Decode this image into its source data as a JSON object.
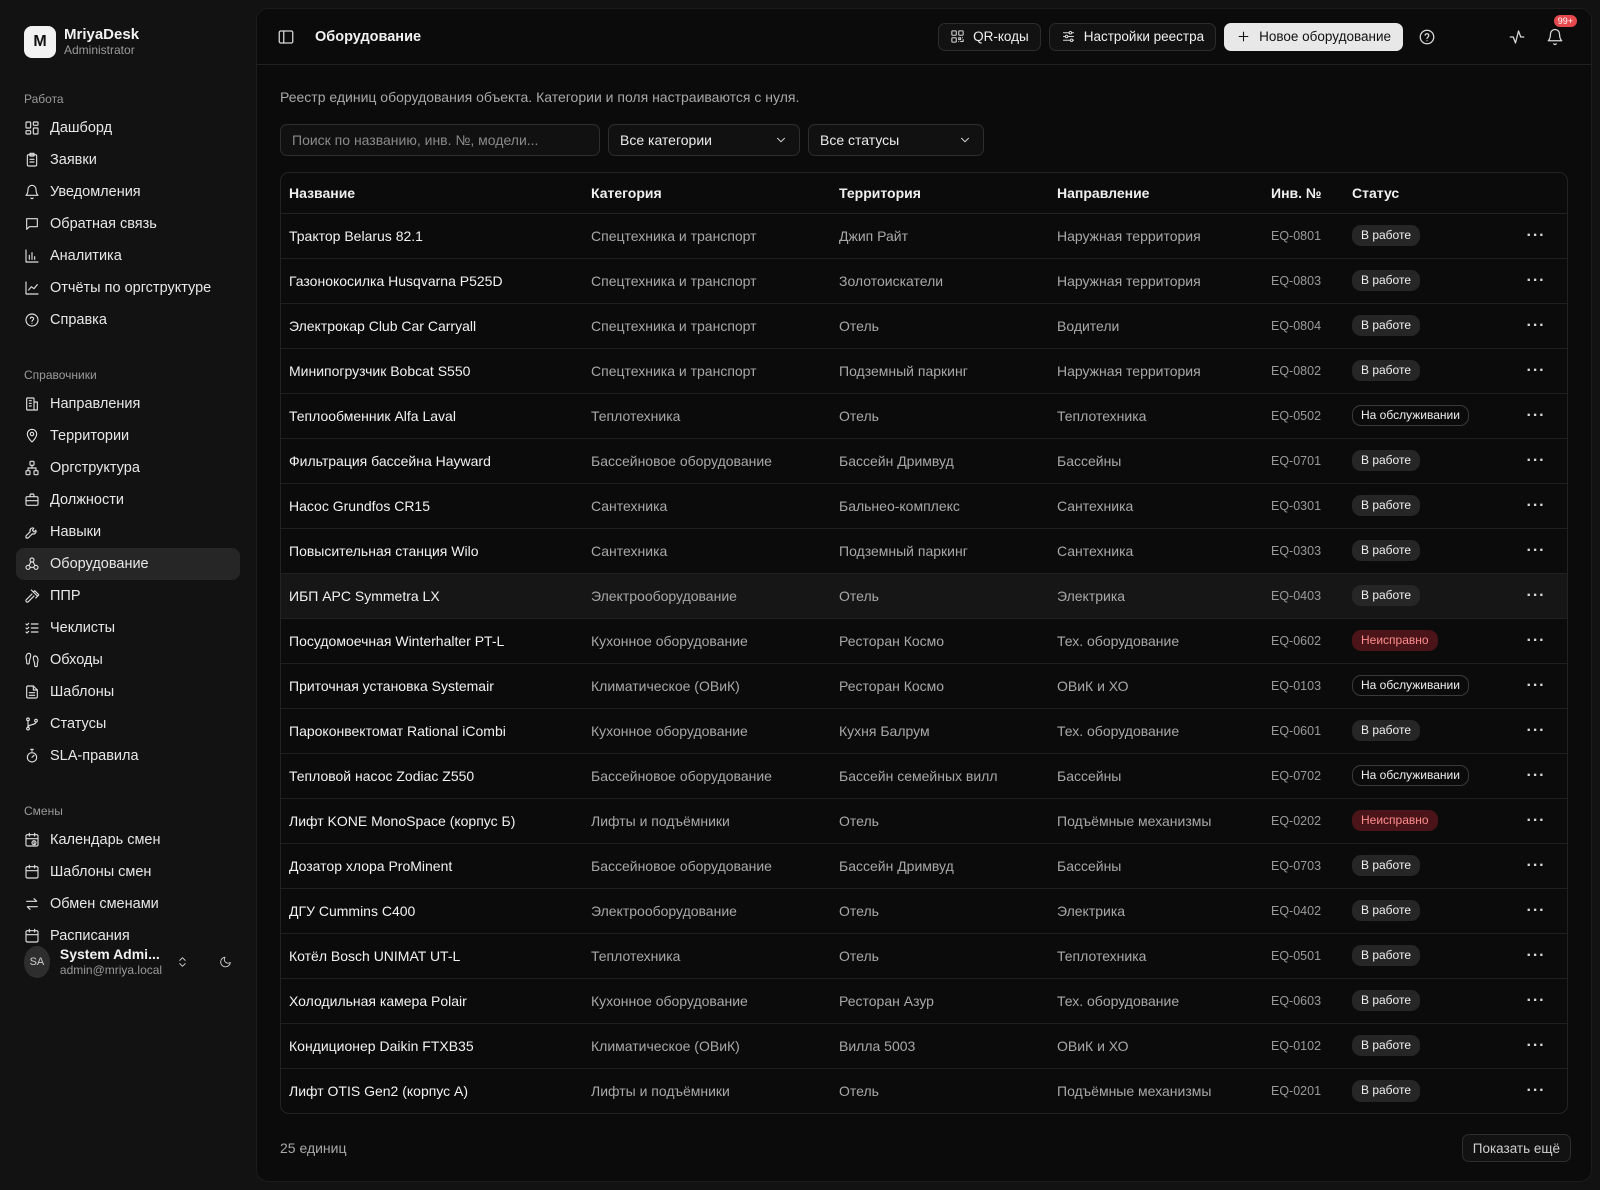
{
  "brand": {
    "logo_letter": "M",
    "name": "MriyaDesk",
    "role": "Administrator"
  },
  "nav_groups": [
    {
      "label": "Работа",
      "items": [
        {
          "label": "Дашборд",
          "icon": "grid-icon"
        },
        {
          "label": "Заявки",
          "icon": "clipboard-icon"
        },
        {
          "label": "Уведомления",
          "icon": "bell-icon"
        },
        {
          "label": "Обратная связь",
          "icon": "message-icon"
        },
        {
          "label": "Аналитика",
          "icon": "bar-chart-icon"
        },
        {
          "label": "Отчёты по оргструктуре",
          "icon": "line-chart-icon"
        },
        {
          "label": "Справка",
          "icon": "help-circle-icon"
        }
      ]
    },
    {
      "label": "Справочники",
      "items": [
        {
          "label": "Направления",
          "icon": "building-icon"
        },
        {
          "label": "Территории",
          "icon": "map-pin-icon"
        },
        {
          "label": "Оргструктура",
          "icon": "network-icon"
        },
        {
          "label": "Должности",
          "icon": "briefcase-icon"
        },
        {
          "label": "Навыки",
          "icon": "wrench-icon"
        },
        {
          "label": "Оборудование",
          "icon": "cogs-icon",
          "active": true
        },
        {
          "label": "ППР",
          "icon": "hammer-icon"
        },
        {
          "label": "Чеклисты",
          "icon": "list-checks-icon"
        },
        {
          "label": "Обходы",
          "icon": "footprints-icon"
        },
        {
          "label": "Шаблоны",
          "icon": "file-text-icon"
        },
        {
          "label": "Статусы",
          "icon": "git-branch-icon"
        },
        {
          "label": "SLA-правила",
          "icon": "timer-icon"
        }
      ]
    },
    {
      "label": "Смены",
      "items": [
        {
          "label": "Календарь смен",
          "icon": "calendar-clock-icon"
        },
        {
          "label": "Шаблоны смен",
          "icon": "calendar-icon"
        },
        {
          "label": "Обмен сменами",
          "icon": "swap-icon"
        },
        {
          "label": "Расписания",
          "icon": "calendar-icon"
        }
      ]
    }
  ],
  "user": {
    "initials": "SA",
    "name": "System Admi...",
    "email": "admin@mriya.local"
  },
  "topbar": {
    "title": "Оборудование",
    "qr_label": "QR-коды",
    "settings_label": "Настройки реестра",
    "new_label": "Новое оборудование",
    "notif_count": "99+"
  },
  "intro": "Реестр единиц оборудования объекта. Категории и поля настраиваются с нуля.",
  "filters": {
    "search_placeholder": "Поиск по названию, инв. №, модели...",
    "category": "Все категории",
    "status": "Все статусы"
  },
  "table": {
    "columns": [
      "Название",
      "Категория",
      "Территория",
      "Направление",
      "Инв. №",
      "Статус"
    ],
    "rows": [
      {
        "name": "Трактор Belarus 82.1",
        "category": "Спецтехника и транспорт",
        "territory": "Джип Райт",
        "direction": "Наружная территория",
        "inv": "EQ-0801",
        "status": "В работе",
        "kind": "ok"
      },
      {
        "name": "Газонокосилка Husqvarna P525D",
        "category": "Спецтехника и транспорт",
        "territory": "Золотоискатели",
        "direction": "Наружная территория",
        "inv": "EQ-0803",
        "status": "В работе",
        "kind": "ok"
      },
      {
        "name": "Электрокар Club Car Carryall",
        "category": "Спецтехника и транспорт",
        "territory": "Отель",
        "direction": "Водители",
        "inv": "EQ-0804",
        "status": "В работе",
        "kind": "ok"
      },
      {
        "name": "Минипогрузчик Bobcat S550",
        "category": "Спецтехника и транспорт",
        "territory": "Подземный паркинг",
        "direction": "Наружная территория",
        "inv": "EQ-0802",
        "status": "В работе",
        "kind": "ok"
      },
      {
        "name": "Теплообменник Alfa Laval",
        "category": "Теплотехника",
        "territory": "Отель",
        "direction": "Теплотехника",
        "inv": "EQ-0502",
        "status": "На обслуживании",
        "kind": "maint"
      },
      {
        "name": "Фильтрация бассейна Hayward",
        "category": "Бассейновое оборудование",
        "territory": "Бассейн Дримвуд",
        "direction": "Бассейны",
        "inv": "EQ-0701",
        "status": "В работе",
        "kind": "ok"
      },
      {
        "name": "Насос Grundfos CR15",
        "category": "Сантехника",
        "territory": "Бальнео-комплекс",
        "direction": "Сантехника",
        "inv": "EQ-0301",
        "status": "В работе",
        "kind": "ok"
      },
      {
        "name": "Повысительная станция Wilo",
        "category": "Сантехника",
        "territory": "Подземный паркинг",
        "direction": "Сантехника",
        "inv": "EQ-0303",
        "status": "В работе",
        "kind": "ok"
      },
      {
        "name": "ИБП APC Symmetra LX",
        "category": "Электрооборудование",
        "territory": "Отель",
        "direction": "Электрика",
        "inv": "EQ-0403",
        "status": "В работе",
        "kind": "ok",
        "highlight": true
      },
      {
        "name": "Посудомоечная Winterhalter PT-L",
        "category": "Кухонное оборудование",
        "territory": "Ресторан Космо",
        "direction": "Тех. оборудование",
        "inv": "EQ-0602",
        "status": "Неисправно",
        "kind": "fault"
      },
      {
        "name": "Приточная установка Systemair",
        "category": "Климатическое (ОВиК)",
        "territory": "Ресторан Космо",
        "direction": "ОВиК и ХО",
        "inv": "EQ-0103",
        "status": "На обслуживании",
        "kind": "maint"
      },
      {
        "name": "Пароконвектомат Rational iCombi",
        "category": "Кухонное оборудование",
        "territory": "Кухня Балрум",
        "direction": "Тех. оборудование",
        "inv": "EQ-0601",
        "status": "В работе",
        "kind": "ok"
      },
      {
        "name": "Тепловой насос Zodiac Z550",
        "category": "Бассейновое оборудование",
        "territory": "Бассейн семейных вилл",
        "direction": "Бассейны",
        "inv": "EQ-0702",
        "status": "На обслуживании",
        "kind": "maint"
      },
      {
        "name": "Лифт KONE MonoSpace (корпус Б)",
        "category": "Лифты и подъёмники",
        "territory": "Отель",
        "direction": "Подъёмные механизмы",
        "inv": "EQ-0202",
        "status": "Неисправно",
        "kind": "fault"
      },
      {
        "name": "Дозатор хлора ProMinent",
        "category": "Бассейновое оборудование",
        "territory": "Бассейн Дримвуд",
        "direction": "Бассейны",
        "inv": "EQ-0703",
        "status": "В работе",
        "kind": "ok"
      },
      {
        "name": "ДГУ Cummins C400",
        "category": "Электрооборудование",
        "territory": "Отель",
        "direction": "Электрика",
        "inv": "EQ-0402",
        "status": "В работе",
        "kind": "ok"
      },
      {
        "name": "Котёл Bosch UNIMAT UT-L",
        "category": "Теплотехника",
        "territory": "Отель",
        "direction": "Теплотехника",
        "inv": "EQ-0501",
        "status": "В работе",
        "kind": "ok"
      },
      {
        "name": "Холодильная камера Polair",
        "category": "Кухонное оборудование",
        "territory": "Ресторан Азур",
        "direction": "Тех. оборудование",
        "inv": "EQ-0603",
        "status": "В работе",
        "kind": "ok"
      },
      {
        "name": "Кондиционер Daikin FTXB35",
        "category": "Климатическое (ОВиК)",
        "territory": "Вилла 5003",
        "direction": "ОВиК и ХО",
        "inv": "EQ-0102",
        "status": "В работе",
        "kind": "ok"
      },
      {
        "name": "Лифт OTIS Gen2 (корпус А)",
        "category": "Лифты и подъёмники",
        "territory": "Отель",
        "direction": "Подъёмные механизмы",
        "inv": "EQ-0201",
        "status": "В работе",
        "kind": "ok"
      }
    ]
  },
  "footer": {
    "count": "25 единиц",
    "show_more": "Показать ещё"
  },
  "colors": {
    "fault_bg": "#4a1418",
    "fault_text": "#ff8d8d",
    "badge_red": "#e5484d"
  }
}
